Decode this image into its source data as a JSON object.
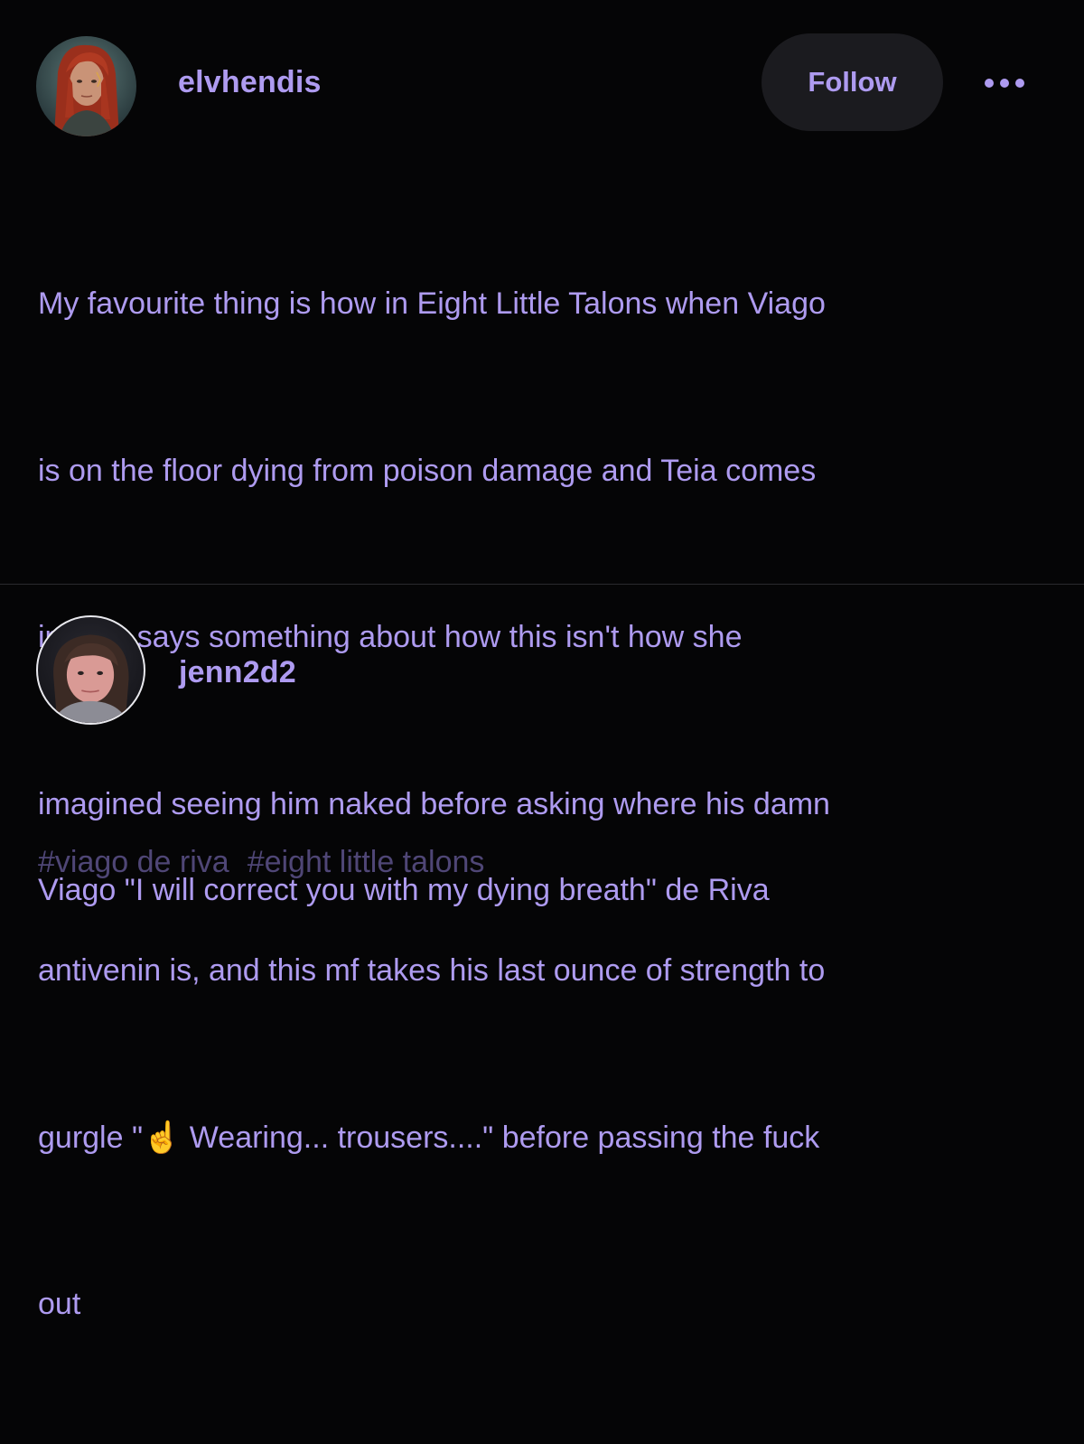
{
  "posts": [
    {
      "username": "elvhendis",
      "follow_label": "Follow",
      "more_icon": "more-horizontal-icon",
      "body_lines": [
        "My favourite thing is how in Eight Little Talons when Viago",
        "is on the floor dying from poison damage and Teia comes",
        "in, she says something about how this isn't how she",
        "imagined seeing him naked before asking where his damn",
        "antivenin is, and this mf takes his last ounce of strength to",
        "gurgle \"☝️ Wearing... trousers....\" before passing the fuck",
        "out"
      ]
    },
    {
      "username": "jenn2d2",
      "body_lines": [
        "Viago \"I will correct you with my dying breath\" de Riva"
      ],
      "tags": [
        "#viago de riva",
        "#eight little talons"
      ]
    }
  ],
  "colors": {
    "background": "#050506",
    "accent": "#ae9bf0",
    "tag": "#4f4676",
    "button_bg": "#1b1b1f",
    "divider": "#2a2a2e"
  }
}
